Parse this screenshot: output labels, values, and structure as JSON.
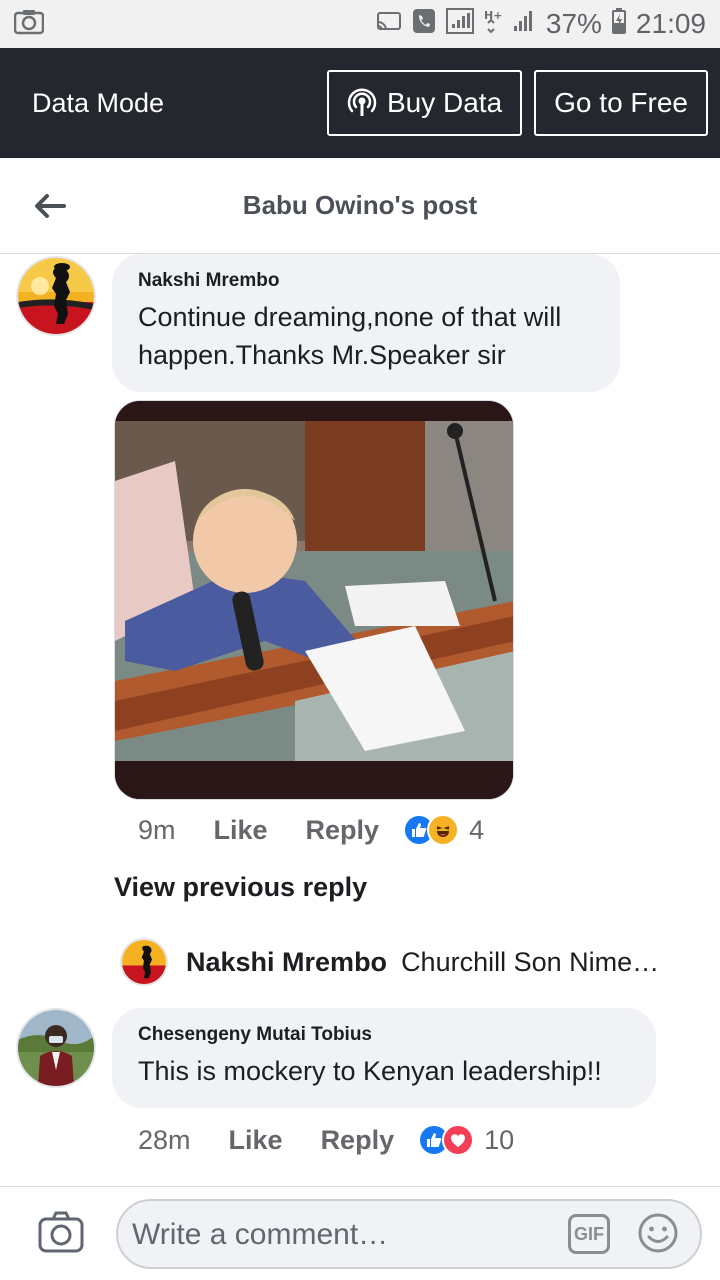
{
  "status_bar": {
    "battery": "37%",
    "time": "21:09",
    "icons": [
      "screenshot-icon",
      "cast-icon",
      "wifi-calling-icon",
      "signal-icon",
      "hplus-icon",
      "signal-icon",
      "battery-icon"
    ]
  },
  "data_bar": {
    "title": "Data Mode",
    "buy_label": "Buy Data",
    "free_label": "Go to Free"
  },
  "header": {
    "title": "Babu Owino's post"
  },
  "comments": [
    {
      "author": "Nakshi Mrembo",
      "text": "Continue dreaming,none of that will happen.Thanks Mr.Speaker sir",
      "time": "9m",
      "like": "Like",
      "reply": "Reply",
      "reaction_count": "4",
      "reactions": [
        "like",
        "haha"
      ]
    },
    {
      "author": "Chesengeny Mutai Tobius",
      "text": "This is mockery to Kenyan leadership!!",
      "time": "28m",
      "like": "Like",
      "reply": "Reply",
      "reaction_count": "10",
      "reactions": [
        "like",
        "love"
      ]
    }
  ],
  "view_previous": "View previous reply",
  "reply_preview": {
    "author": "Nakshi Mrembo",
    "text": "Churchill Son Nimechoka"
  },
  "composer": {
    "placeholder": "Write a comment…",
    "gif_label": "GIF"
  },
  "colors": {
    "data_bar_bg": "#24272d",
    "bubble_bg": "#f0f2f5",
    "like_blue": "#1877f2",
    "love_red": "#f33e58",
    "haha_yellow": "#f7b125"
  }
}
